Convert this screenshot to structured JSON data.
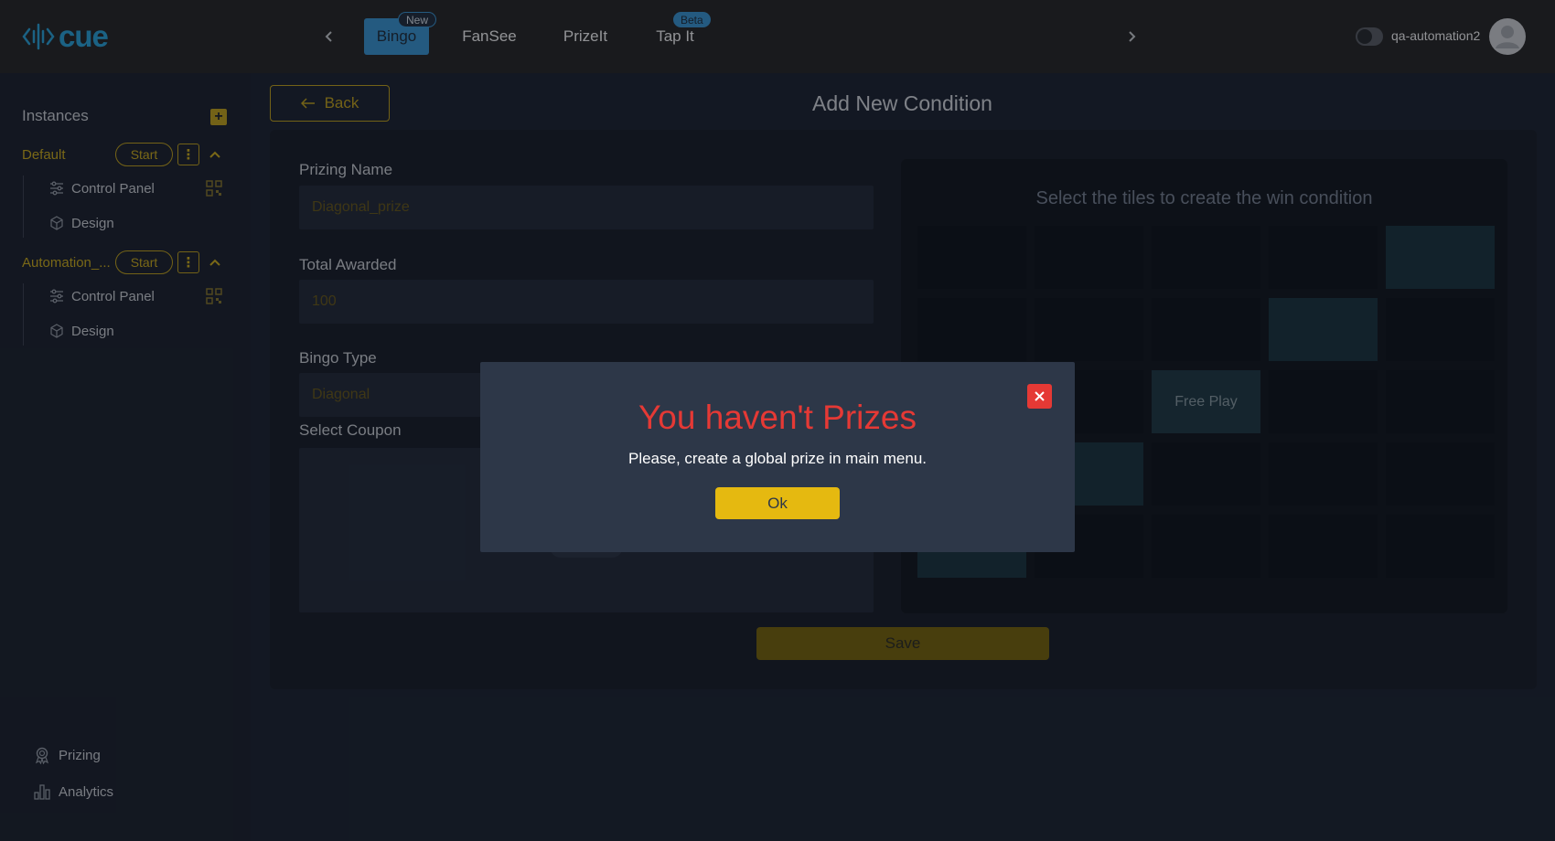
{
  "header": {
    "logo_text": "cue",
    "tabs": [
      {
        "label": "Bingo",
        "badge": "New"
      },
      {
        "label": "FanSee"
      },
      {
        "label": "PrizeIt"
      },
      {
        "label": "Tap It",
        "badge": "Beta"
      }
    ],
    "username": "qa-automation2"
  },
  "sidebar": {
    "instances_title": "Instances",
    "instances": [
      {
        "name": "Default",
        "start_label": "Start",
        "items": [
          "Control Panel",
          "Design"
        ]
      },
      {
        "name": "Automation_...",
        "start_label": "Start",
        "items": [
          "Control Panel",
          "Design"
        ]
      }
    ],
    "bottom": [
      "Prizing",
      "Analytics"
    ]
  },
  "main": {
    "back_label": "Back",
    "title": "Add New Condition",
    "prizing_name_label": "Prizing Name",
    "prizing_name_value": "Diagonal_prize",
    "total_awarded_label": "Total Awarded",
    "total_awarded_value": "100",
    "bingo_type_label": "Bingo Type",
    "bingo_type_value": "Diagonal",
    "select_coupon_label": "Select Coupon",
    "grid_title": "Select the tiles to create the win condition",
    "free_tile_label": "Free Play",
    "save_label": "Save"
  },
  "modal": {
    "title": "You haven't Prizes",
    "message": "Please, create a global prize in main menu.",
    "ok_label": "Ok"
  },
  "colors": {
    "accent_yellow": "#e5b910",
    "accent_blue": "#3a9ad9",
    "error_red": "#e53935",
    "selected_tile": "#18343e"
  }
}
